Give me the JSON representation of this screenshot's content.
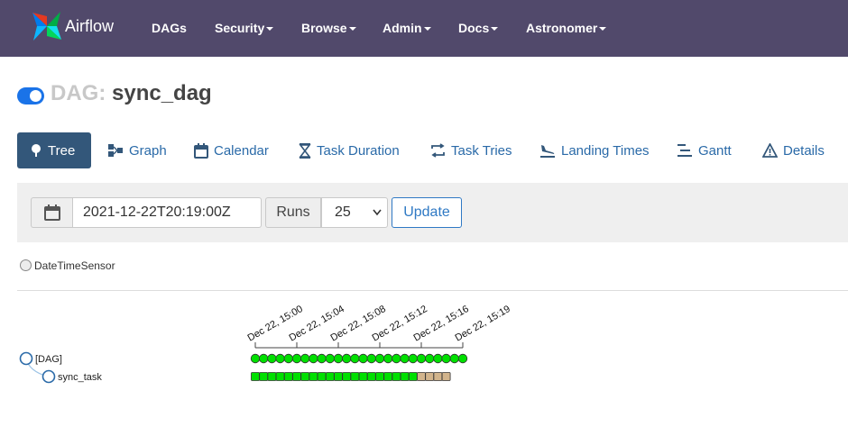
{
  "navbar": {
    "brand": "Airflow",
    "items": [
      {
        "label": "DAGs",
        "dropdown": false
      },
      {
        "label": "Security",
        "dropdown": true
      },
      {
        "label": "Browse",
        "dropdown": true
      },
      {
        "label": "Admin",
        "dropdown": true
      },
      {
        "label": "Docs",
        "dropdown": true
      },
      {
        "label": "Astronomer",
        "dropdown": true
      }
    ]
  },
  "title": {
    "prefix": "DAG:",
    "name": "sync_dag"
  },
  "tabs": [
    {
      "label": "Tree",
      "icon": "tree-icon",
      "active": true
    },
    {
      "label": "Graph",
      "icon": "graph-icon",
      "active": false
    },
    {
      "label": "Calendar",
      "icon": "calendar-icon",
      "active": false
    },
    {
      "label": "Task Duration",
      "icon": "hourglass-icon",
      "active": false
    },
    {
      "label": "Task Tries",
      "icon": "retry-icon",
      "active": false
    },
    {
      "label": "Landing Times",
      "icon": "plane-landing-icon",
      "active": false
    },
    {
      "label": "Gantt",
      "icon": "gantt-icon",
      "active": false
    },
    {
      "label": "Details",
      "icon": "warning-triangle-icon",
      "active": false
    }
  ],
  "form": {
    "date_value": "2021-12-22T20:19:00Z",
    "runs_label": "Runs",
    "runs_value": "25",
    "update_label": "Update"
  },
  "legend": {
    "label": "DateTimeSensor"
  },
  "tree": {
    "root_label": "[DAG]",
    "task_label": "sync_task",
    "date_labels": [
      "Dec 22, 15:00",
      "Dec 22, 15:04",
      "Dec 22, 15:08",
      "Dec 22, 15:12",
      "Dec 22, 15:16",
      "Dec 22, 15:19"
    ],
    "dag_runs": [
      "success",
      "success",
      "success",
      "success",
      "success",
      "success",
      "success",
      "success",
      "success",
      "success",
      "success",
      "success",
      "success",
      "success",
      "success",
      "success",
      "success",
      "success",
      "success",
      "success",
      "success",
      "success",
      "success",
      "success",
      "success",
      "success"
    ],
    "task_instances": [
      "success",
      "success",
      "success",
      "success",
      "success",
      "success",
      "success",
      "success",
      "success",
      "success",
      "success",
      "success",
      "success",
      "success",
      "success",
      "success",
      "success",
      "success",
      "success",
      "success",
      "up_for_reschedule",
      "up_for_reschedule",
      "up_for_reschedule",
      "up_for_reschedule"
    ]
  },
  "colors": {
    "navbar": "#51496b",
    "active_tab": "#33577a",
    "link": "#2a6aa8",
    "success": "#00e000",
    "up_for_reschedule": "#d2b48c",
    "toggle_on": "#1a73e8"
  }
}
